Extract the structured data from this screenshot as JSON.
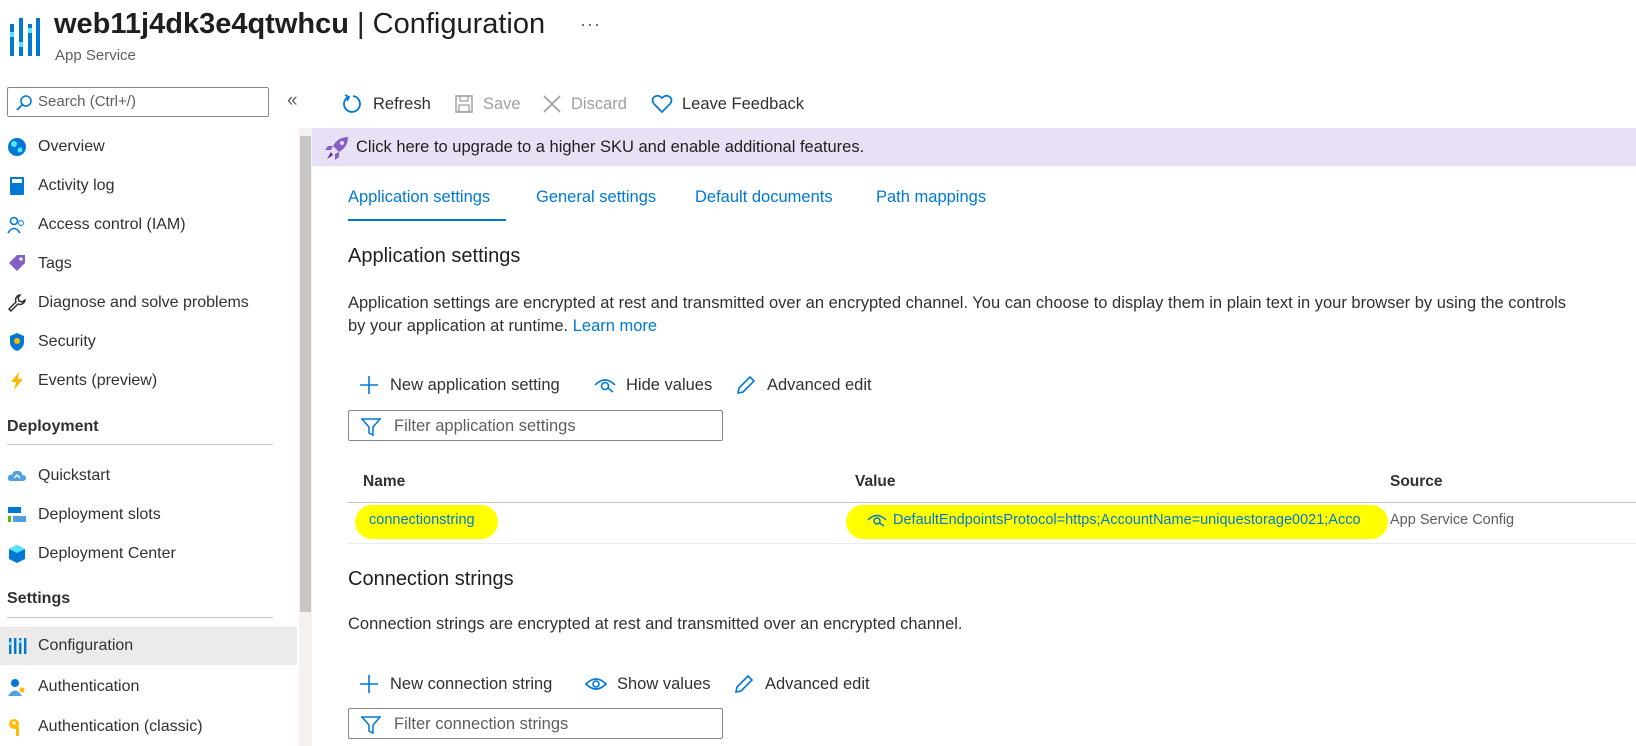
{
  "header": {
    "title_resource": "web11j4dk3e4qtwhcu",
    "title_sep": " | ",
    "title_page": "Configuration",
    "subtitle": "App Service",
    "more": "···"
  },
  "sidebar": {
    "search_placeholder": "Search (Ctrl+/)",
    "collapse": "«",
    "items_top": [
      {
        "label": "Overview",
        "icon": "globe-icon"
      },
      {
        "label": "Activity log",
        "icon": "book-icon"
      },
      {
        "label": "Access control (IAM)",
        "icon": "people-icon"
      },
      {
        "label": "Tags",
        "icon": "tag-icon"
      },
      {
        "label": "Diagnose and solve problems",
        "icon": "wrench-icon"
      },
      {
        "label": "Security",
        "icon": "shield-icon"
      },
      {
        "label": "Events (preview)",
        "icon": "lightning-icon"
      }
    ],
    "section_deployment": "Deployment",
    "items_deployment": [
      {
        "label": "Quickstart",
        "icon": "cloud-icon"
      },
      {
        "label": "Deployment slots",
        "icon": "slots-icon"
      },
      {
        "label": "Deployment Center",
        "icon": "cube-icon"
      }
    ],
    "section_settings": "Settings",
    "items_settings": [
      {
        "label": "Configuration",
        "icon": "sliders-icon"
      },
      {
        "label": "Authentication",
        "icon": "person-key-icon"
      },
      {
        "label": "Authentication (classic)",
        "icon": "key-icon"
      }
    ]
  },
  "toolbar": {
    "refresh": "Refresh",
    "save": "Save",
    "discard": "Discard",
    "feedback": "Leave Feedback"
  },
  "banner": {
    "text": "Click here to upgrade to a higher SKU and enable additional features."
  },
  "tabs": [
    "Application settings",
    "General settings",
    "Default documents",
    "Path mappings"
  ],
  "app_settings": {
    "heading": "Application settings",
    "desc_line1": "Application settings are encrypted at rest and transmitted over an encrypted channel. You can choose to display them in plain text in your browser by using the controls",
    "desc_line2": "by your application at runtime.",
    "learn_more": "Learn more",
    "new_btn": "New application setting",
    "hide_btn": "Hide values",
    "advanced_btn": "Advanced edit",
    "filter_placeholder": "Filter application settings",
    "columns": {
      "name": "Name",
      "value": "Value",
      "source": "Source"
    },
    "rows": [
      {
        "name": "connectionstring",
        "value": "DefaultEndpointsProtocol=https;AccountName=uniquestorage0021;Acco",
        "source": "App Service Config"
      }
    ]
  },
  "conn_strings": {
    "heading": "Connection strings",
    "desc": "Connection strings are encrypted at rest and transmitted over an encrypted channel.",
    "new_btn": "New connection string",
    "show_btn": "Show values",
    "advanced_btn": "Advanced edit",
    "filter_placeholder": "Filter connection strings"
  },
  "colors": {
    "accent": "#0078d4",
    "banner_bg": "#e8e0f5",
    "highlight": "#ffff00",
    "active_nav": "#edebe9"
  }
}
